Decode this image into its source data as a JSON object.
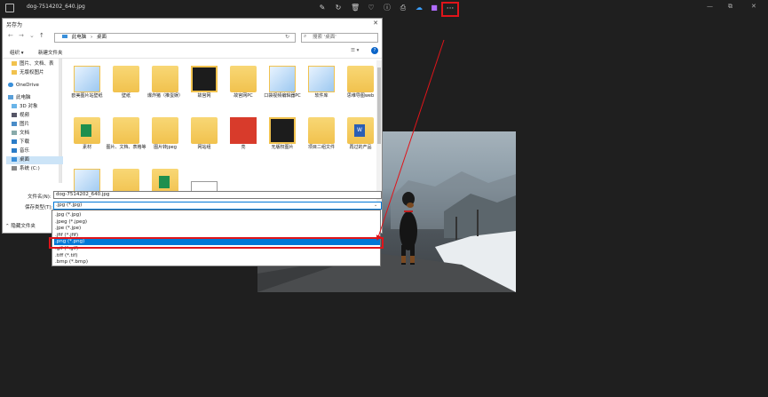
{
  "app": {
    "title": "dog-7514202_640.jpg",
    "toolbar_icons": [
      "edit-icon",
      "rotate-icon",
      "delete-icon",
      "favorite-icon",
      "info-icon",
      "print-icon",
      "onedrive-icon",
      "clipchamp-icon"
    ],
    "more_label": "···",
    "window_controls": [
      "—",
      "⧉",
      "✕"
    ]
  },
  "dialog": {
    "title": "另存为",
    "close_label": "✕",
    "nav": {
      "back": "←",
      "forward": "→",
      "up": "↑",
      "recent": "⌄"
    },
    "address": {
      "path": [
        "此电脑",
        "桌面"
      ],
      "separator": "›"
    },
    "search_placeholder": "搜索 '桌面'",
    "organize_label": "组织 ▾",
    "new_folder_label": "新建文件夹",
    "sidebar": [
      {
        "label": "图片、文档、表"
      },
      {
        "label": "无版权图片"
      },
      {
        "label": "OneDrive"
      },
      {
        "label": "此电脑"
      },
      {
        "label": "3D 对象"
      },
      {
        "label": "视频"
      },
      {
        "label": "图片"
      },
      {
        "label": "文档"
      },
      {
        "label": "下载"
      },
      {
        "label": "音乐"
      },
      {
        "label": "桌面"
      },
      {
        "label": "系统 (C:)"
      }
    ],
    "files": [
      {
        "label": "欧美图片站壁纸",
        "kind": "doc"
      },
      {
        "label": "壁纸",
        "kind": "folder"
      },
      {
        "label": "爆炸猪（推蛋娱）",
        "kind": "folder"
      },
      {
        "label": "故宫网",
        "kind": "dark"
      },
      {
        "label": "故宫网PC",
        "kind": "folder"
      },
      {
        "label": "口袋视频编辑器PC",
        "kind": "doc"
      },
      {
        "label": "软件库",
        "kind": "doc"
      },
      {
        "label": "思维导图web",
        "kind": "folder"
      },
      {
        "label": "素材",
        "kind": "green"
      },
      {
        "label": "图片、文档、表格等",
        "kind": "folder"
      },
      {
        "label": "图片转jpeg",
        "kind": "folder"
      },
      {
        "label": "网站组",
        "kind": "folder"
      },
      {
        "label": "亮",
        "kind": "red"
      },
      {
        "label": "无版权图片",
        "kind": "dark"
      },
      {
        "label": "项目二组文件",
        "kind": "folder"
      },
      {
        "label": "再过的产品",
        "kind": "word"
      },
      {
        "label": "",
        "kind": "doc"
      },
      {
        "label": "",
        "kind": "folder"
      },
      {
        "label": "",
        "kind": "green"
      },
      {
        "label": "",
        "kind": "screen"
      }
    ],
    "filename_label": "文件名(N):",
    "filename_value": "dog-7514202_640.jpg",
    "savetype_label": "保存类型(T):",
    "savetype_value": ".jpg (*.jpg)",
    "hide_folders_label": "隐藏文件夹",
    "type_options": [
      ".jpg (*.jpg)",
      ".jpeg (*.jpeg)",
      ".jpe (*.jpe)",
      ".jfif (*.jfif)",
      ".png (*.png)",
      ".gif (*.gif)",
      ".tiff (*.tif)",
      ".bmp (*.bmp)"
    ],
    "selected_option_index": 4
  },
  "colors": {
    "app_bg": "#1f1f1f",
    "highlight_red": "#e0141a",
    "select_blue": "#0078d7"
  }
}
